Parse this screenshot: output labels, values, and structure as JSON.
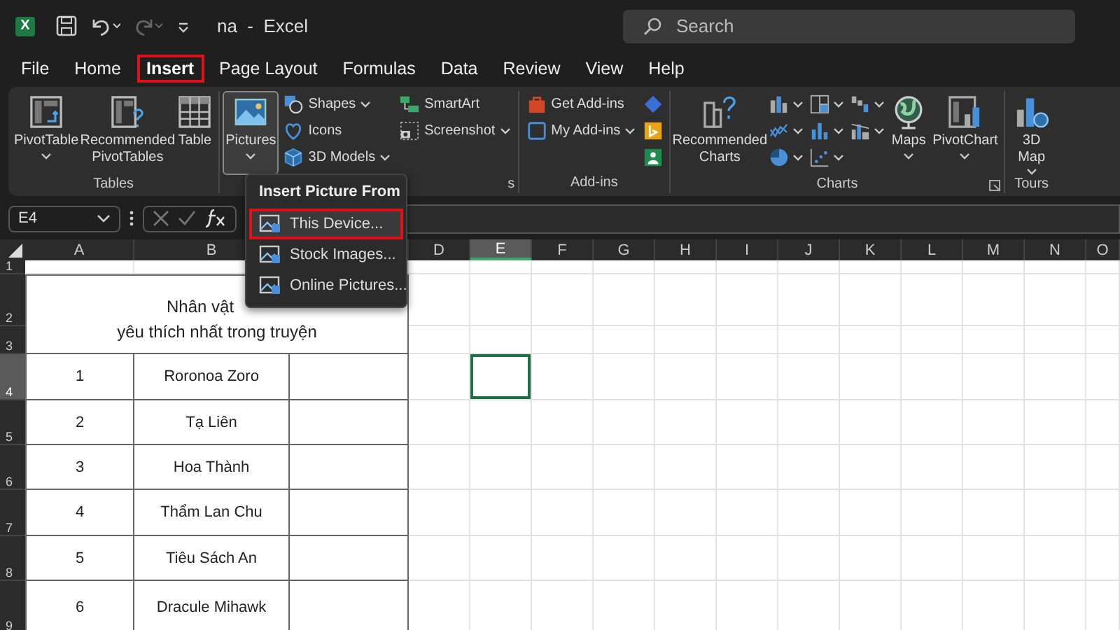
{
  "title_bar": {
    "logo_letter": "X",
    "title": "na  -  Excel",
    "redo_disabled": true,
    "search": {
      "placeholder": "Search"
    }
  },
  "tabs": [
    {
      "label": "File",
      "selected": false
    },
    {
      "label": "Home",
      "selected": false
    },
    {
      "label": "Insert",
      "selected": true
    },
    {
      "label": "Page Layout",
      "selected": false
    },
    {
      "label": "Formulas",
      "selected": false
    },
    {
      "label": "Data",
      "selected": false
    },
    {
      "label": "Review",
      "selected": false
    },
    {
      "label": "View",
      "selected": false
    },
    {
      "label": "Help",
      "selected": false
    }
  ],
  "ribbon": [
    {
      "label": "Tables",
      "columns": [
        [
          {
            "kind": "large",
            "label": "PivotTable",
            "dropdown": true,
            "pressed": false
          }
        ],
        [
          {
            "kind": "large",
            "label": "Recommended PivotTables",
            "dropdown": false,
            "pressed": false
          }
        ],
        [
          {
            "kind": "large",
            "label": "Table",
            "dropdown": false,
            "pressed": false
          }
        ]
      ]
    },
    {
      "label": "s",
      "columns": [
        [
          {
            "kind": "large",
            "label": "Pictures",
            "dropdown": true,
            "pressed": true
          }
        ],
        [
          {
            "kind": "small",
            "label": "Shapes",
            "dropdown": true,
            "pressed": false
          },
          {
            "kind": "small",
            "label": "Icons",
            "dropdown": false,
            "pressed": false
          },
          {
            "kind": "small",
            "label": "3D Models",
            "dropdown": true,
            "pressed": false
          }
        ],
        [
          {
            "kind": "small",
            "label": "SmartArt",
            "dropdown": false,
            "pressed": false
          },
          {
            "kind": "small",
            "label": "Screenshot",
            "dropdown": true,
            "pressed": false
          }
        ]
      ]
    },
    {
      "label": "Add-ins",
      "columns": [
        [
          {
            "kind": "small",
            "label": "Get Add-ins",
            "dropdown": false,
            "pressed": false
          },
          {
            "kind": "small",
            "label": "My Add-ins",
            "dropdown": true,
            "pressed": false
          }
        ],
        [
          {
            "kind": "icon",
            "dropdown": false,
            "pressed": false
          },
          {
            "kind": "icon",
            "dropdown": false,
            "pressed": false
          },
          {
            "kind": "icon",
            "dropdown": false,
            "pressed": false
          }
        ]
      ]
    },
    {
      "label": "Charts",
      "launcher": true,
      "columns": [
        [
          {
            "kind": "large",
            "label": "Recommended Charts",
            "dropdown": false,
            "pressed": false
          }
        ],
        [
          {
            "kind": "icon",
            "dropdown": true,
            "pressed": false
          },
          {
            "kind": "icon",
            "dropdown": true,
            "pressed": false
          },
          {
            "kind": "icon",
            "dropdown": true,
            "pressed": false
          }
        ],
        [
          {
            "kind": "icon",
            "dropdown": true,
            "pressed": false
          },
          {
            "kind": "icon",
            "dropdown": true,
            "pressed": false
          },
          {
            "kind": "icon",
            "dropdown": true,
            "pressed": false
          }
        ],
        [
          {
            "kind": "icon",
            "dropdown": true,
            "pressed": false
          },
          {
            "kind": "icon",
            "dropdown": true,
            "pressed": false
          }
        ],
        [
          {
            "kind": "large",
            "label": "Maps",
            "dropdown": true,
            "pressed": false
          }
        ],
        [
          {
            "kind": "large",
            "label": "PivotChart",
            "dropdown": true,
            "pressed": false
          }
        ]
      ]
    },
    {
      "label": "Tours",
      "columns": [
        [
          {
            "kind": "large",
            "label": "3D Map",
            "dropdown": true,
            "pressed": false
          }
        ]
      ]
    }
  ],
  "formula_bar": {
    "name_box": "E4"
  },
  "menu": {
    "title": "Insert Picture From",
    "items": [
      {
        "label": "This Device...",
        "selected": true
      },
      {
        "label": "Stock Images...",
        "selected": false
      },
      {
        "label": "Online Pictures...",
        "selected": false
      }
    ]
  },
  "sheet": {
    "columns": [
      {
        "label": "A",
        "selected": false
      },
      {
        "label": "B",
        "selected": false
      },
      {
        "selected": false
      },
      {
        "label": "D",
        "selected": false
      },
      {
        "label": "E",
        "selected": true
      },
      {
        "label": "F",
        "selected": false
      },
      {
        "label": "G",
        "selected": false
      },
      {
        "label": "H",
        "selected": false
      },
      {
        "label": "I",
        "selected": false
      },
      {
        "label": "J",
        "selected": false
      },
      {
        "label": "K",
        "selected": false
      },
      {
        "label": "L",
        "selected": false
      },
      {
        "label": "M",
        "selected": false
      },
      {
        "label": "N",
        "selected": false
      },
      {
        "label": "O",
        "selected": false
      }
    ],
    "rows": [
      {
        "label": "1",
        "selected": false
      },
      {
        "label": "2",
        "selected": false
      },
      {
        "label": "3",
        "selected": false
      },
      {
        "label": "4",
        "selected": true
      },
      {
        "label": "5",
        "selected": false
      },
      {
        "label": "6",
        "selected": false
      },
      {
        "label": "7",
        "selected": false
      },
      {
        "label": "8",
        "selected": false
      },
      {
        "label": "9",
        "selected": false
      }
    ],
    "title": [
      "Nhân vật",
      "yêu thích nhất trong truyện"
    ],
    "records": [
      {
        "no": "1",
        "name": "Roronoa Zoro"
      },
      {
        "no": "2",
        "name": "Tạ Liên"
      },
      {
        "no": "3",
        "name": "Hoa Thành"
      },
      {
        "no": "4",
        "name": "Thẩm Lan Chu"
      },
      {
        "no": "5",
        "name": "Tiêu Sách An"
      },
      {
        "no": "6",
        "name": "Dracule Mihawk"
      }
    ]
  }
}
